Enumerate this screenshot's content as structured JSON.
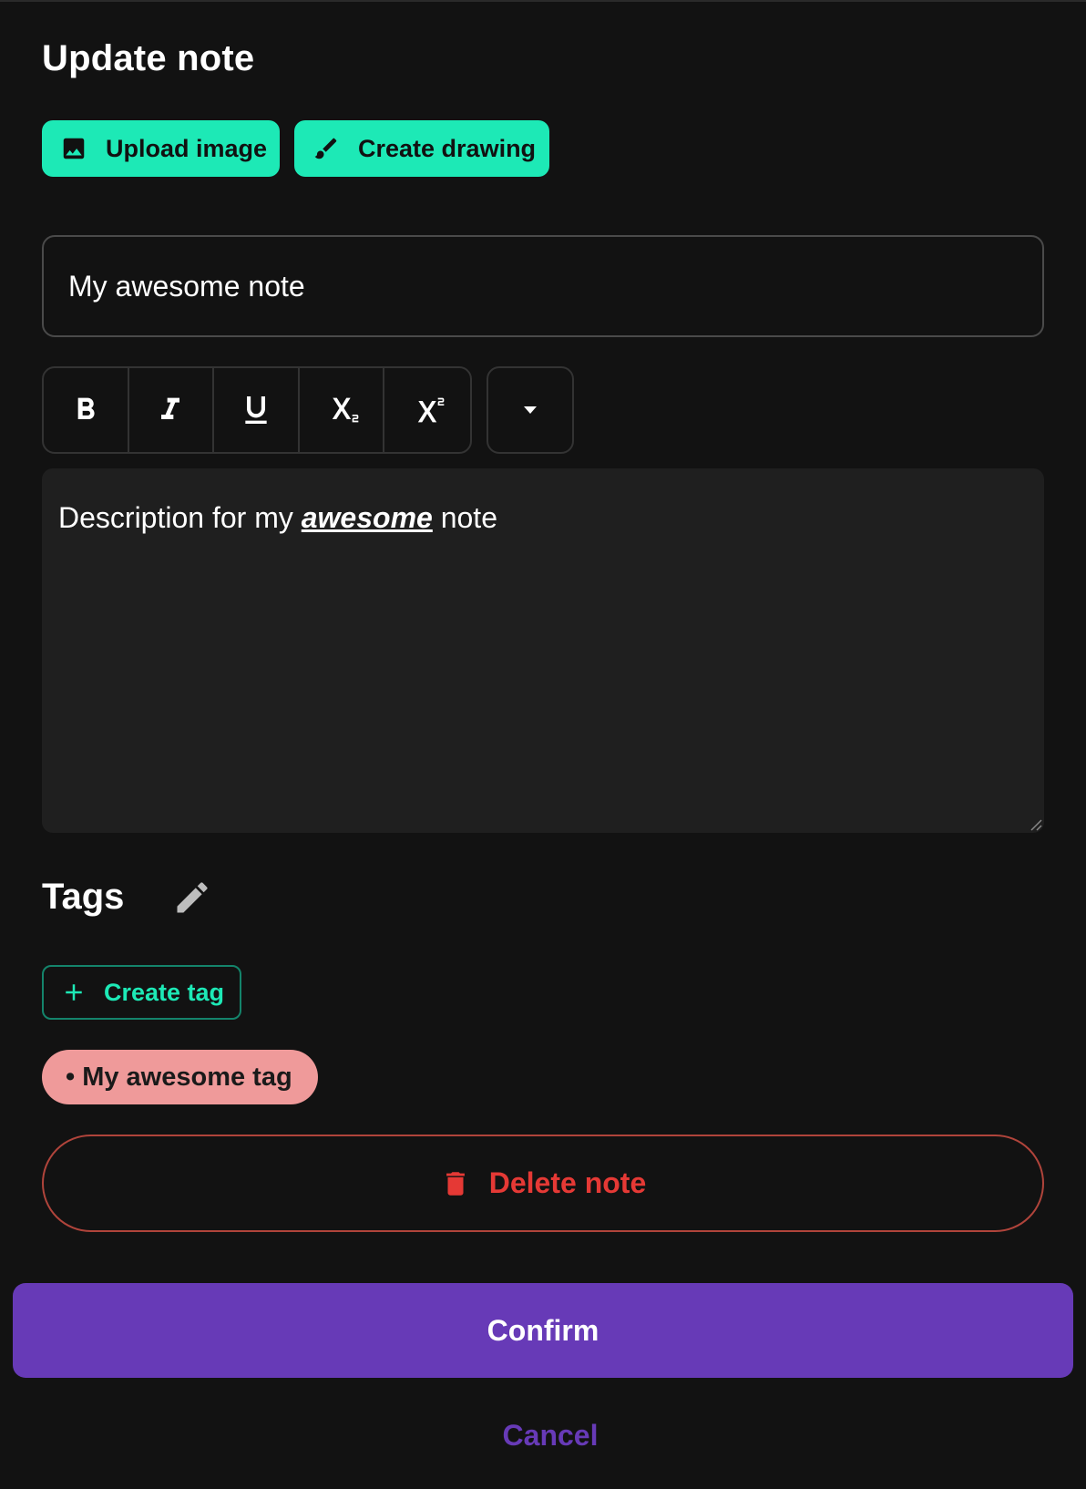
{
  "dialog": {
    "title": "Update note"
  },
  "media": {
    "upload_label": "Upload image",
    "upload_icon": "image-icon",
    "draw_label": "Create drawing",
    "draw_icon": "brush-icon"
  },
  "note": {
    "title_value": "My awesome note",
    "description_before": "Description for my ",
    "description_emphasis": "awesome",
    "description_after": " note"
  },
  "toolbar": {
    "tools": [
      "bold",
      "italic",
      "underline",
      "subscript",
      "superscript"
    ],
    "more_icon": "caret-down-icon"
  },
  "tags": {
    "label": "Tags",
    "edit_icon": "pencil-icon",
    "create_label": "Create tag",
    "items": [
      {
        "label": "• My awesome tag",
        "color": "#ef9a9a"
      }
    ]
  },
  "actions": {
    "delete_label": "Delete note",
    "confirm_label": "Confirm",
    "cancel_label": "Cancel"
  },
  "colors": {
    "background": "#121212",
    "accent": "#1de9b6",
    "primary": "#673ab7",
    "danger": "#e53935",
    "editor_bg": "#1f1f1f"
  }
}
